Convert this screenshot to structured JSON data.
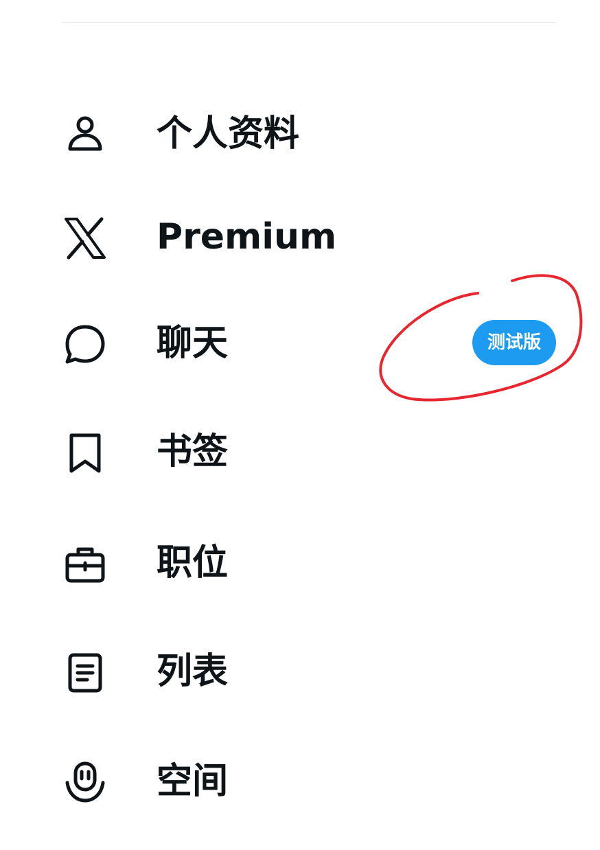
{
  "menu": {
    "items": [
      {
        "label": "个人资料",
        "icon": "person-icon"
      },
      {
        "label": "Premium",
        "icon": "x-logo-icon"
      },
      {
        "label": "聊天",
        "icon": "chat-bubble-icon",
        "badge": "测试版"
      },
      {
        "label": "书签",
        "icon": "bookmark-icon"
      },
      {
        "label": "职位",
        "icon": "briefcase-icon"
      },
      {
        "label": "列表",
        "icon": "list-icon"
      },
      {
        "label": "空间",
        "icon": "spaces-icon"
      }
    ]
  },
  "colors": {
    "text": "#0f1419",
    "badge_bg": "#1d9bf0",
    "badge_text": "#ffffff",
    "annotation": "#e8262f",
    "divider": "#e6e8ea"
  }
}
